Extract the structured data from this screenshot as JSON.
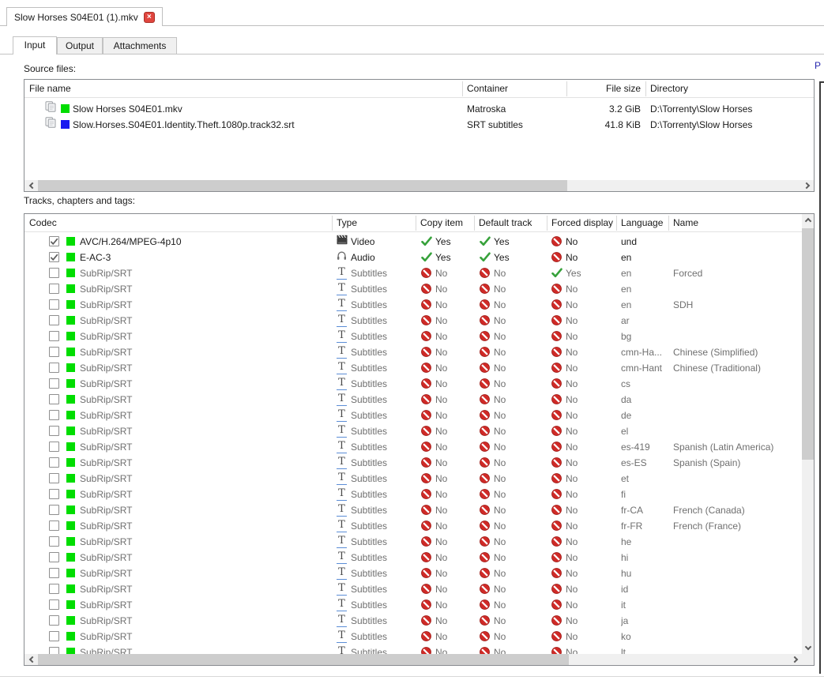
{
  "window": {
    "document_tab": {
      "title": "Slow Horses S04E01 (1).mkv",
      "close_icon": "×"
    }
  },
  "tabs": {
    "input": "Input",
    "output": "Output",
    "attachments": "Attachments"
  },
  "right_panel": {
    "cutoff_text": "P"
  },
  "colors": {
    "track_green": "#00dd00",
    "file_blue": "#1a1af0",
    "yes_green": "#36a13a",
    "no_red": "#cf2a27"
  },
  "source_files": {
    "label": "Source files:",
    "columns": [
      "File name",
      "Container",
      "File size",
      "Directory"
    ],
    "rows": [
      {
        "file_name": "Slow Horses S04E01.mkv",
        "container": "Matroska",
        "file_size": "3.2 GiB",
        "directory": "D:\\Torrenty\\Slow Horses",
        "color": "#00dd00"
      },
      {
        "file_name": "Slow.Horses.S04E01.Identity.Theft.1080p.track32.srt",
        "container": "SRT subtitles",
        "file_size": "41.8 KiB",
        "directory": "D:\\Torrenty\\Slow Horses",
        "color": "#1a1af0"
      }
    ]
  },
  "tracks": {
    "label": "Tracks, chapters and tags:",
    "columns": [
      "Codec",
      "Type",
      "Copy item",
      "Default track",
      "Forced display",
      "Language",
      "Name"
    ],
    "rows": [
      {
        "codec": "AVC/H.264/MPEG-4p10",
        "type": "Video",
        "copy": "Yes",
        "default_track": "Yes",
        "forced": "No",
        "language": "und",
        "name": "",
        "checked": true,
        "color": "#00dd00"
      },
      {
        "codec": "E-AC-3",
        "type": "Audio",
        "copy": "Yes",
        "default_track": "Yes",
        "forced": "No",
        "language": "en",
        "name": "",
        "checked": true,
        "color": "#00dd00"
      },
      {
        "codec": "SubRip/SRT",
        "type": "Subtitles",
        "copy": "No",
        "default_track": "No",
        "forced": "Yes",
        "language": "en",
        "name": "Forced",
        "checked": false,
        "color": "#00dd00"
      },
      {
        "codec": "SubRip/SRT",
        "type": "Subtitles",
        "copy": "No",
        "default_track": "No",
        "forced": "No",
        "language": "en",
        "name": "",
        "checked": false,
        "color": "#00dd00"
      },
      {
        "codec": "SubRip/SRT",
        "type": "Subtitles",
        "copy": "No",
        "default_track": "No",
        "forced": "No",
        "language": "en",
        "name": "SDH",
        "checked": false,
        "color": "#00dd00"
      },
      {
        "codec": "SubRip/SRT",
        "type": "Subtitles",
        "copy": "No",
        "default_track": "No",
        "forced": "No",
        "language": "ar",
        "name": "",
        "checked": false,
        "color": "#00dd00"
      },
      {
        "codec": "SubRip/SRT",
        "type": "Subtitles",
        "copy": "No",
        "default_track": "No",
        "forced": "No",
        "language": "bg",
        "name": "",
        "checked": false,
        "color": "#00dd00"
      },
      {
        "codec": "SubRip/SRT",
        "type": "Subtitles",
        "copy": "No",
        "default_track": "No",
        "forced": "No",
        "language": "cmn-Ha...",
        "name": "Chinese (Simplified)",
        "checked": false,
        "color": "#00dd00"
      },
      {
        "codec": "SubRip/SRT",
        "type": "Subtitles",
        "copy": "No",
        "default_track": "No",
        "forced": "No",
        "language": "cmn-Hant",
        "name": "Chinese (Traditional)",
        "checked": false,
        "color": "#00dd00"
      },
      {
        "codec": "SubRip/SRT",
        "type": "Subtitles",
        "copy": "No",
        "default_track": "No",
        "forced": "No",
        "language": "cs",
        "name": "",
        "checked": false,
        "color": "#00dd00"
      },
      {
        "codec": "SubRip/SRT",
        "type": "Subtitles",
        "copy": "No",
        "default_track": "No",
        "forced": "No",
        "language": "da",
        "name": "",
        "checked": false,
        "color": "#00dd00"
      },
      {
        "codec": "SubRip/SRT",
        "type": "Subtitles",
        "copy": "No",
        "default_track": "No",
        "forced": "No",
        "language": "de",
        "name": "",
        "checked": false,
        "color": "#00dd00"
      },
      {
        "codec": "SubRip/SRT",
        "type": "Subtitles",
        "copy": "No",
        "default_track": "No",
        "forced": "No",
        "language": "el",
        "name": "",
        "checked": false,
        "color": "#00dd00"
      },
      {
        "codec": "SubRip/SRT",
        "type": "Subtitles",
        "copy": "No",
        "default_track": "No",
        "forced": "No",
        "language": "es-419",
        "name": "Spanish (Latin America)",
        "checked": false,
        "color": "#00dd00"
      },
      {
        "codec": "SubRip/SRT",
        "type": "Subtitles",
        "copy": "No",
        "default_track": "No",
        "forced": "No",
        "language": "es-ES",
        "name": "Spanish (Spain)",
        "checked": false,
        "color": "#00dd00"
      },
      {
        "codec": "SubRip/SRT",
        "type": "Subtitles",
        "copy": "No",
        "default_track": "No",
        "forced": "No",
        "language": "et",
        "name": "",
        "checked": false,
        "color": "#00dd00"
      },
      {
        "codec": "SubRip/SRT",
        "type": "Subtitles",
        "copy": "No",
        "default_track": "No",
        "forced": "No",
        "language": "fi",
        "name": "",
        "checked": false,
        "color": "#00dd00"
      },
      {
        "codec": "SubRip/SRT",
        "type": "Subtitles",
        "copy": "No",
        "default_track": "No",
        "forced": "No",
        "language": "fr-CA",
        "name": "French (Canada)",
        "checked": false,
        "color": "#00dd00"
      },
      {
        "codec": "SubRip/SRT",
        "type": "Subtitles",
        "copy": "No",
        "default_track": "No",
        "forced": "No",
        "language": "fr-FR",
        "name": "French (France)",
        "checked": false,
        "color": "#00dd00"
      },
      {
        "codec": "SubRip/SRT",
        "type": "Subtitles",
        "copy": "No",
        "default_track": "No",
        "forced": "No",
        "language": "he",
        "name": "",
        "checked": false,
        "color": "#00dd00"
      },
      {
        "codec": "SubRip/SRT",
        "type": "Subtitles",
        "copy": "No",
        "default_track": "No",
        "forced": "No",
        "language": "hi",
        "name": "",
        "checked": false,
        "color": "#00dd00"
      },
      {
        "codec": "SubRip/SRT",
        "type": "Subtitles",
        "copy": "No",
        "default_track": "No",
        "forced": "No",
        "language": "hu",
        "name": "",
        "checked": false,
        "color": "#00dd00"
      },
      {
        "codec": "SubRip/SRT",
        "type": "Subtitles",
        "copy": "No",
        "default_track": "No",
        "forced": "No",
        "language": "id",
        "name": "",
        "checked": false,
        "color": "#00dd00"
      },
      {
        "codec": "SubRip/SRT",
        "type": "Subtitles",
        "copy": "No",
        "default_track": "No",
        "forced": "No",
        "language": "it",
        "name": "",
        "checked": false,
        "color": "#00dd00"
      },
      {
        "codec": "SubRip/SRT",
        "type": "Subtitles",
        "copy": "No",
        "default_track": "No",
        "forced": "No",
        "language": "ja",
        "name": "",
        "checked": false,
        "color": "#00dd00"
      },
      {
        "codec": "SubRip/SRT",
        "type": "Subtitles",
        "copy": "No",
        "default_track": "No",
        "forced": "No",
        "language": "ko",
        "name": "",
        "checked": false,
        "color": "#00dd00"
      },
      {
        "codec": "SubRip/SRT",
        "type": "Subtitles",
        "copy": "No",
        "default_track": "No",
        "forced": "No",
        "language": "lt",
        "name": "",
        "checked": false,
        "color": "#00dd00"
      }
    ]
  }
}
